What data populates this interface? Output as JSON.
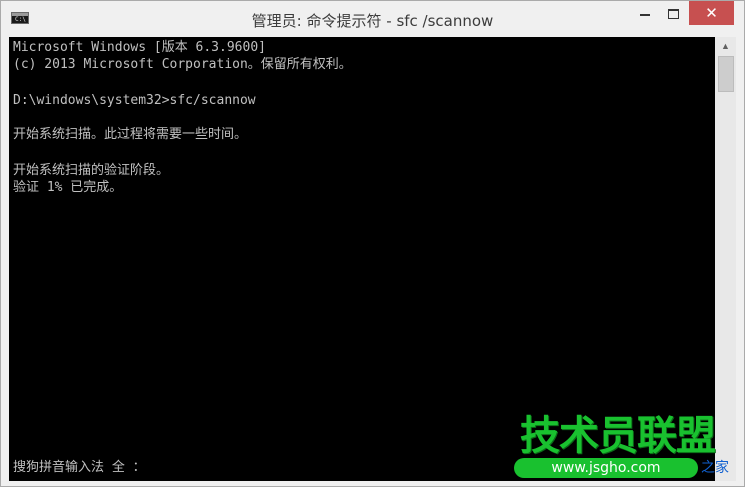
{
  "window": {
    "title": "管理员: 命令提示符 - sfc /scannow",
    "icon_label": "C:\\",
    "close_glyph": "✕"
  },
  "console": {
    "lines": [
      "Microsoft Windows [版本 6.3.9600]",
      "(c) 2013 Microsoft Corporation。保留所有权利。",
      "D:\\windows\\system32>sfc/scannow",
      "开始系统扫描。此过程将需要一些时间。",
      "开始系统扫描的验证阶段。",
      "验证 1% 已完成。"
    ],
    "ime_status": "搜狗拼音输入法 全 ："
  },
  "scrollbar": {
    "up_glyph": "▲"
  },
  "watermark": {
    "brand": "技术员联盟",
    "url": "www.jsgho.com",
    "tail": "之家"
  },
  "colors": {
    "console_bg": "#000000",
    "console_text": "#c0c0c0",
    "close_button": "#c75050",
    "watermark_green": "#19c12f"
  },
  "icons": [
    "cmd-app-icon",
    "minimize-icon",
    "maximize-icon",
    "close-icon",
    "scroll-up-arrow-icon"
  ]
}
